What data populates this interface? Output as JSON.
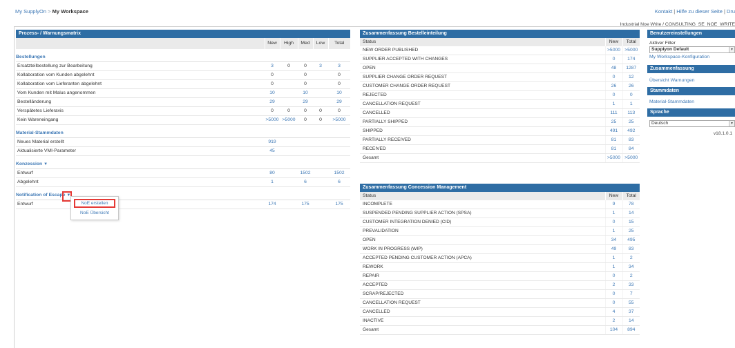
{
  "breadcrumb": {
    "root": "My SupplyOn",
    "sep": " > ",
    "current": "My Workspace"
  },
  "toplinks": {
    "contact": "Kontakt",
    "help": "Hilfe zu dieser Seite",
    "print": "Dru"
  },
  "user_line": "Industrial Noe Write / CONSULTING_SE_NOE_WRITE",
  "matrix": {
    "title": "Prozess- / Warnungsmatrix",
    "columns": [
      "",
      "New",
      "High",
      "Med",
      "Low",
      "Total"
    ],
    "sections": [
      {
        "title": "Bestellungen",
        "rows": [
          {
            "label": "Ersatzteilbestellung zur Bearbeitung",
            "values": [
              "3",
              "0",
              "0",
              "3",
              "3"
            ]
          },
          {
            "label": "Kollaboration vom Kunden abgelehnt",
            "values": [
              "0",
              "",
              "0",
              "",
              "0"
            ]
          },
          {
            "label": "Kollaboration vom Lieferanten abgelehnt",
            "values": [
              "0",
              "",
              "0",
              "",
              "0"
            ]
          },
          {
            "label": "Vom Kunden mit Malus angenommen",
            "values": [
              "10",
              "",
              "10",
              "",
              "10"
            ]
          },
          {
            "label": "Bestelländerung",
            "values": [
              "29",
              "",
              "29",
              "",
              "29"
            ]
          },
          {
            "label": "Verspätetes Lieferavis",
            "values": [
              "0",
              "0",
              "0",
              "0",
              "0"
            ]
          },
          {
            "label": "Kein Wareneingang",
            "values": [
              ">5000",
              ">5000",
              "0",
              "0",
              ">5000"
            ]
          }
        ]
      },
      {
        "title": "Material-Stammdaten",
        "rows": [
          {
            "label": "Neues Material erstellt",
            "values": [
              "919",
              "",
              "",
              "",
              ""
            ]
          },
          {
            "label": "Aktualisierte VMI-Parameter",
            "values": [
              "45",
              "",
              "",
              "",
              ""
            ]
          }
        ]
      },
      {
        "title": "Konzession",
        "dropdown": true,
        "rows": [
          {
            "label": "Entwurf",
            "values": [
              "80",
              "",
              "1502",
              "",
              "1502"
            ]
          },
          {
            "label": "Abgelehnt",
            "values": [
              "1",
              "",
              "6",
              "",
              "6"
            ]
          }
        ]
      },
      {
        "title": "Notification of Escape",
        "dropdown": true,
        "rows": [
          {
            "label": "Entwurf",
            "values": [
              "174",
              "",
              "175",
              "",
              "175"
            ]
          }
        ]
      }
    ]
  },
  "noe_menu": {
    "create": "NoE erstellen",
    "overview": "NoE Übersicht"
  },
  "bestell": {
    "title": "Zusammenfassung Bestelleinteilung",
    "columns": [
      "Status",
      "New",
      "Total"
    ],
    "rows": [
      {
        "status": "NEW ORDER PUBLISHED",
        "new": ">5000",
        "total": ">5000"
      },
      {
        "status": "SUPPLIER ACCEPTED WITH CHANGES",
        "new": "0",
        "total": "174"
      },
      {
        "status": "OPEN",
        "new": "48",
        "total": "1287"
      },
      {
        "status": "SUPPLIER CHANGE ORDER REQUEST",
        "new": "0",
        "total": "12"
      },
      {
        "status": "CUSTOMER CHANGE ORDER REQUEST",
        "new": "26",
        "total": "26"
      },
      {
        "status": "REJECTED",
        "new": "0",
        "total": "0"
      },
      {
        "status": "CANCELLATION REQUEST",
        "new": "1",
        "total": "1"
      },
      {
        "status": "CANCELLED",
        "new": "111",
        "total": "113"
      },
      {
        "status": "PARTIALLY SHIPPED",
        "new": "25",
        "total": "25"
      },
      {
        "status": "SHIPPED",
        "new": "491",
        "total": "492"
      },
      {
        "status": "PARTIALLY RECEIVED",
        "new": "81",
        "total": "83"
      },
      {
        "status": "RECEIVED",
        "new": "81",
        "total": "84"
      },
      {
        "status": "Gesamt",
        "new": ">5000",
        "total": ">5000"
      }
    ]
  },
  "concess": {
    "title": "Zusammenfassung Concession Management",
    "columns": [
      "Status",
      "New",
      "Total"
    ],
    "rows": [
      {
        "status": "INCOMPLETE",
        "new": "9",
        "total": "78"
      },
      {
        "status": "SUSPENDED PENDING SUPPLIER ACTION (SPSA)",
        "new": "1",
        "total": "14"
      },
      {
        "status": "CUSTOMER INTEGRATION DENIED (CID)",
        "new": "0",
        "total": "15"
      },
      {
        "status": "PREVALIDATION",
        "new": "1",
        "total": "25"
      },
      {
        "status": "OPEN",
        "new": "34",
        "total": "495"
      },
      {
        "status": "WORK IN PROGRESS (WIP)",
        "new": "49",
        "total": "83"
      },
      {
        "status": "ACCEPTED PENDING CUSTOMER ACTION (APCA)",
        "new": "1",
        "total": "2"
      },
      {
        "status": "REWORK",
        "new": "1",
        "total": "34"
      },
      {
        "status": "REPAIR",
        "new": "0",
        "total": "2"
      },
      {
        "status": "ACCEPTED",
        "new": "2",
        "total": "33"
      },
      {
        "status": "SCRAP/REJECTED",
        "new": "0",
        "total": "7"
      },
      {
        "status": "CANCELLATION REQUEST",
        "new": "0",
        "total": "55"
      },
      {
        "status": "CANCELLED",
        "new": "4",
        "total": "37"
      },
      {
        "status": "INACTIVE",
        "new": "2",
        "total": "14"
      },
      {
        "status": "Gesamt",
        "new": "104",
        "total": "894"
      }
    ]
  },
  "sidebar": {
    "settings_title": "Benutzereinstellungen",
    "filter_label": "Aktiver Filter",
    "filter_value": "Supplyon Default",
    "workspace_config": "My Workspace-Konfiguration",
    "summary_title": "Zusammenfassung",
    "warnings_link": "Übersicht Warnungen",
    "master_title": "Stammdaten",
    "master_link": "Material-Stammdaten",
    "language_title": "Sprache",
    "language_value": "Deutsch",
    "version": "v18.1.0.1"
  },
  "colors": {
    "header_blue": "#2e6da4",
    "link_blue": "#3d78b5",
    "highlight_red": "#e53935"
  }
}
